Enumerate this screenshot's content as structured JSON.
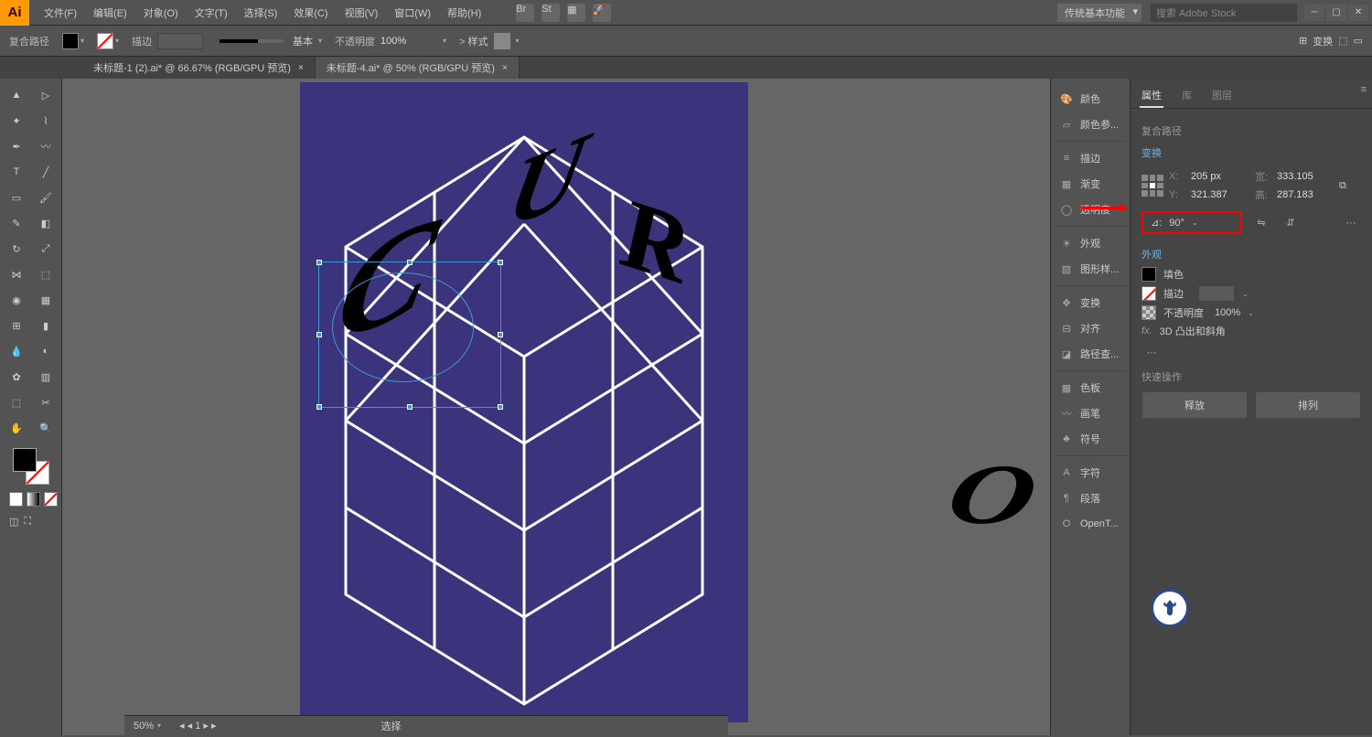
{
  "app_logo": "Ai",
  "menu": [
    "文件(F)",
    "编辑(E)",
    "对象(O)",
    "文字(T)",
    "选择(S)",
    "效果(C)",
    "视图(V)",
    "窗口(W)",
    "帮助(H)"
  ],
  "workspace": "传统基本功能",
  "search_placeholder": "搜索 Adobe Stock",
  "optbar": {
    "label": "复合路径",
    "stroke_label": "描边",
    "stroke_value": "",
    "profile_label": "基本",
    "opacity_label": "不透明度",
    "opacity_value": "100%",
    "style_label": "样式",
    "transform_label": "变换"
  },
  "tabs": [
    {
      "name": "未标题-1 (2).ai* @ 66.67% (RGB/GPU 预览)",
      "active": false
    },
    {
      "name": "未标题-4.ai* @ 50% (RGB/GPU 预览)",
      "active": true
    }
  ],
  "status": {
    "zoom": "50%",
    "page": "1",
    "tool": "选择"
  },
  "dock": [
    {
      "icon": "palette",
      "label": "颜色"
    },
    {
      "icon": "guide",
      "label": "颜色参..."
    },
    {
      "div": true
    },
    {
      "icon": "lines",
      "label": "描边"
    },
    {
      "icon": "grad",
      "label": "渐变"
    },
    {
      "icon": "circle",
      "label": "透明度"
    },
    {
      "div": true
    },
    {
      "icon": "sun",
      "label": "外观"
    },
    {
      "icon": "styles",
      "label": "图形样..."
    },
    {
      "div": true
    },
    {
      "icon": "transform",
      "label": "变换"
    },
    {
      "icon": "align",
      "label": "对齐"
    },
    {
      "icon": "path",
      "label": "路径查..."
    },
    {
      "div": true
    },
    {
      "icon": "swatches",
      "label": "色板"
    },
    {
      "icon": "brushes",
      "label": "画笔"
    },
    {
      "icon": "symbols",
      "label": "符号"
    },
    {
      "div": true
    },
    {
      "icon": "A",
      "label": "字符"
    },
    {
      "icon": "para",
      "label": "段落"
    },
    {
      "icon": "O",
      "label": "OpenT..."
    }
  ],
  "props": {
    "tabs": [
      "属性",
      "库",
      "图层"
    ],
    "active_tab": "属性",
    "selection_type": "复合路径",
    "transform_title": "变换",
    "x_label": "X:",
    "x_value": "205 px",
    "y_label": "Y:",
    "y_value": "321.387",
    "w_label": "宽:",
    "w_value": "333.105",
    "h_label": "高:",
    "h_value": "287.183",
    "rot_label": "⊿:",
    "rot_value": "90°",
    "appearance_title": "外观",
    "fill_label": "填色",
    "stroke_label": "描边",
    "opacity_label": "不透明度",
    "opacity_value": "100%",
    "fx_prefix": "fx.",
    "fx_label": "3D 凸出和斜角",
    "quick_title": "快速操作",
    "btn_release": "释放",
    "btn_arrange": "排列"
  }
}
